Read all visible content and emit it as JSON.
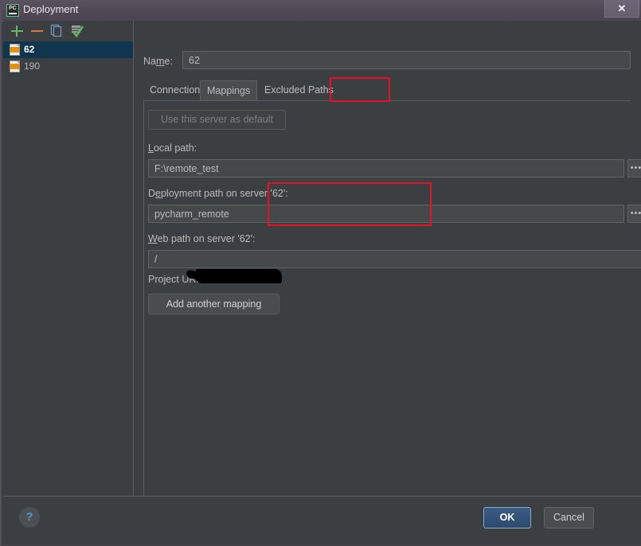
{
  "window": {
    "title": "Deployment",
    "app_icon": "pycharm-logo-icon",
    "close_label": "✕"
  },
  "sidebar": {
    "toolbar": [
      {
        "name": "add-server-button",
        "icon": "plus-icon",
        "label": "+",
        "color": "#67b76a"
      },
      {
        "name": "remove-server-button",
        "icon": "minus-icon",
        "label": "−",
        "color": "#d4764a"
      },
      {
        "name": "copy-server-button",
        "icon": "copy-icon",
        "label": "",
        "color": "#6b9dc6"
      },
      {
        "name": "set-default-button",
        "icon": "checkmark-icon",
        "label": "",
        "color": "#5eb85e"
      }
    ],
    "servers": [
      {
        "label": "62",
        "icon": "sftp-icon",
        "selected": true
      },
      {
        "label": "190",
        "icon": "sftp-icon",
        "selected": false
      }
    ]
  },
  "form": {
    "name_label": "Name:",
    "name_label_pre": "Na",
    "name_label_mnemonic": "m",
    "name_label_post": "e:",
    "name_value": "62",
    "tabs": [
      {
        "label": "Connection",
        "active": false
      },
      {
        "label": "Mappings",
        "active": true
      },
      {
        "label": "Excluded Paths",
        "active": false
      }
    ],
    "use_default_button": "Use this server as default",
    "use_default_enabled": false,
    "local_path": {
      "label_pre": "",
      "label_mnemonic": "L",
      "label_post": "ocal path:",
      "label": "Local path:",
      "value": "F:\\remote_test",
      "browse_label": "•••"
    },
    "deployment_path": {
      "label_pre": "D",
      "label_mnemonic": "e",
      "label_post": "ployment path on server '62':",
      "label": "Deployment path on server '62':",
      "value": "pycharm_remote",
      "browse_label": "•••"
    },
    "web_path": {
      "label_pre": "",
      "label_mnemonic": "W",
      "label_post": "eb path on server '62':",
      "label": "Web path on server '62':",
      "value": "/"
    },
    "project_url": {
      "label": "Project URL:",
      "value_redacted": true
    },
    "add_mapping_button": "Add another mapping"
  },
  "footer": {
    "help_label": "?",
    "ok_label": "OK",
    "cancel_label": "Cancel"
  },
  "annotations": [
    {
      "name": "annotation-mappings-tab",
      "color": "#e81123"
    },
    {
      "name": "annotation-deployment-path",
      "color": "#e81123"
    }
  ]
}
